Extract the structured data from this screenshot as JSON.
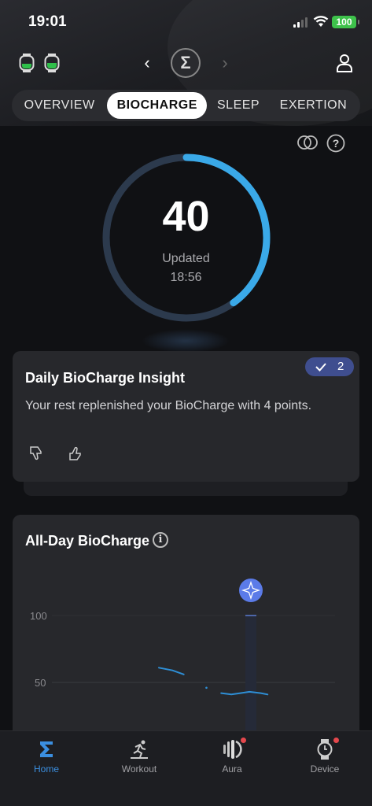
{
  "status_bar": {
    "time": "19:01",
    "battery": "100",
    "battery_color": "#3ec24b"
  },
  "header": {
    "left_icons": [
      "watch-icon",
      "watch-icon"
    ],
    "logo_glyph": "Σ",
    "prev_label": "‹",
    "next_label": "›"
  },
  "tabs": [
    {
      "label": "OVERVIEW",
      "active": false
    },
    {
      "label": "BIOCHARGE",
      "active": true
    },
    {
      "label": "SLEEP",
      "active": false
    },
    {
      "label": "EXERTION",
      "active": false
    }
  ],
  "gauge": {
    "score": "40",
    "max": 100,
    "updated_label": "Updated",
    "updated_time": "18:56",
    "accent": "#3aa9e8"
  },
  "insight": {
    "title": "Daily BioCharge Insight",
    "text": "Your rest replenished your BioCharge with 4 points.",
    "badge_count": "2"
  },
  "all_day": {
    "title": "All-Day BioCharge",
    "y_tick_100": "100",
    "y_tick_50": "50"
  },
  "chart_data": {
    "type": "line",
    "title": "All-Day BioCharge",
    "y_ticks": [
      "100",
      "50"
    ],
    "ylim": [
      0,
      130
    ],
    "series": [
      {
        "values": [
          [
            0.0,
            61
          ],
          [
            0.12,
            59
          ],
          [
            0.22,
            56
          ]
        ]
      },
      {
        "values": [
          [
            0.42,
            46
          ]
        ]
      },
      {
        "values": [
          [
            0.55,
            42
          ],
          [
            0.64,
            41
          ],
          [
            0.72,
            42
          ],
          [
            0.8,
            43
          ],
          [
            0.9,
            42
          ],
          [
            0.96,
            41
          ]
        ]
      }
    ],
    "marker_value": 100
  },
  "nav": [
    {
      "label": "Home",
      "active": true,
      "dot": false
    },
    {
      "label": "Workout",
      "active": false,
      "dot": false
    },
    {
      "label": "Aura",
      "active": false,
      "dot": true
    },
    {
      "label": "Device",
      "active": false,
      "dot": true
    }
  ]
}
